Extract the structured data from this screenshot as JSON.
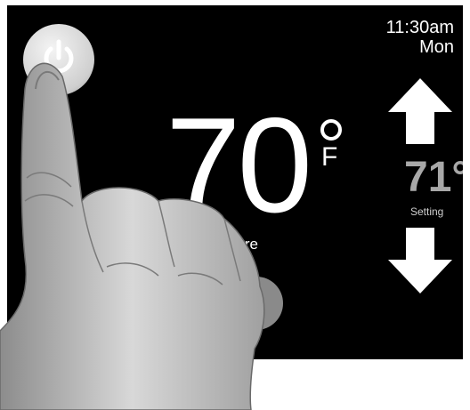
{
  "device": {
    "clock": {
      "time": "11:30am",
      "day": "Mon"
    },
    "current_temperature": {
      "value": "70",
      "unit": "F",
      "label": "emperature"
    },
    "setpoint": {
      "value": "71°",
      "label": "Setting"
    },
    "icons": {
      "power": "power-icon",
      "up": "arrow-up-icon",
      "down": "arrow-down-icon",
      "hand": "hand-image"
    }
  }
}
